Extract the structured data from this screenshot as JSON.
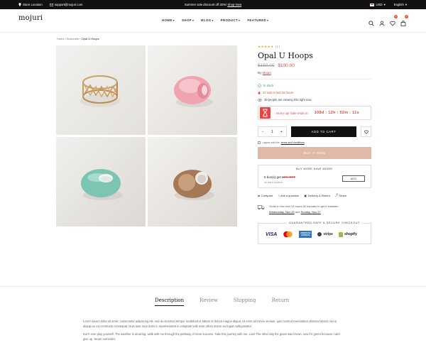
{
  "topbar": {
    "store_location": "Store Location",
    "email": "support@mojuri.com",
    "promo_text": "Summer sale discount off 30%!",
    "promo_link": "Shop Now",
    "currency": "USD",
    "language": "English"
  },
  "header": {
    "logo": "mojuri",
    "nav": [
      "HOME",
      "SHOP",
      "BLOG",
      "PRODUCT",
      "FEATURED"
    ],
    "wishlist_count": "0",
    "cart_count": "0"
  },
  "breadcrumb": [
    "Home",
    "Bracelets",
    "Opal U Hoops"
  ],
  "gallery": {
    "images": [
      "gold-lattice-ring",
      "pink-dome-ring",
      "turquoise-dome-ring",
      "brown-marbled-ring"
    ]
  },
  "product": {
    "rating": 5,
    "stars": "★★★★★",
    "review_count": "(1)",
    "title": "Opal U Hoops",
    "old_price": "$150.00",
    "new_price": "$100.00",
    "by_label": "By",
    "vendor": "Mojuri",
    "stock": "In stock",
    "sold": "37 sold in last 18 hours",
    "viewing": "39 people are viewing this right now",
    "sale_label": "Hurry up! Sale ends in:",
    "countdown": "108d : 12h : 52m : 11s",
    "quantity": "1",
    "add_to_cart": "ADD TO CART",
    "agree_text": "I agree with the",
    "agree_link": "terms and conditions",
    "buy_now": "BUY IT NOW"
  },
  "bundle": {
    "title": "BUY MORE SAVE MORE!",
    "offer": "5 box(s) get",
    "discount": "10% OFF",
    "note": "on each product",
    "add_label": "ADD"
  },
  "actions": [
    "Compare",
    "Ask a question",
    "Delivery & Return",
    "Share"
  ],
  "delivery": {
    "line1": "Order in the next 12 hours 52 minutes to get it between",
    "date_start": "Wednesday, Nov 23",
    "and": "and",
    "date_end": "Sunday, Nov 27"
  },
  "secure": {
    "title": "GUARANTEED SAFE & SECURE CHECKOUT",
    "logos": [
      "VISA",
      "mastercard",
      "AMERICAN EXPRESS",
      "stripe",
      "shopify"
    ]
  },
  "tabs": [
    "Description",
    "Review",
    "Shipping",
    "Return"
  ],
  "description": {
    "p1": "Lorem ipsum dolor sit amet, consectetur adipiscing elit, sed do eiusmod tempor incididunt ut labore et dolore magna aliqua. Ut enim ad minim veniam, quis nostrud exercitation ullamco laboris nisi ut aliquip ex ea commodo consequat. Duis aute irure dolor in reprehenderit in voluptate velit esse cillum dolore eu fugiat nulla pariatur.",
    "p2": "Don't ever play yourself. The weather is amazing, walk with me through the pathway of more success. Take this journey with me, Lion! The other day the grass was brown, now it's green because I ain't give up. Never surrender."
  }
}
